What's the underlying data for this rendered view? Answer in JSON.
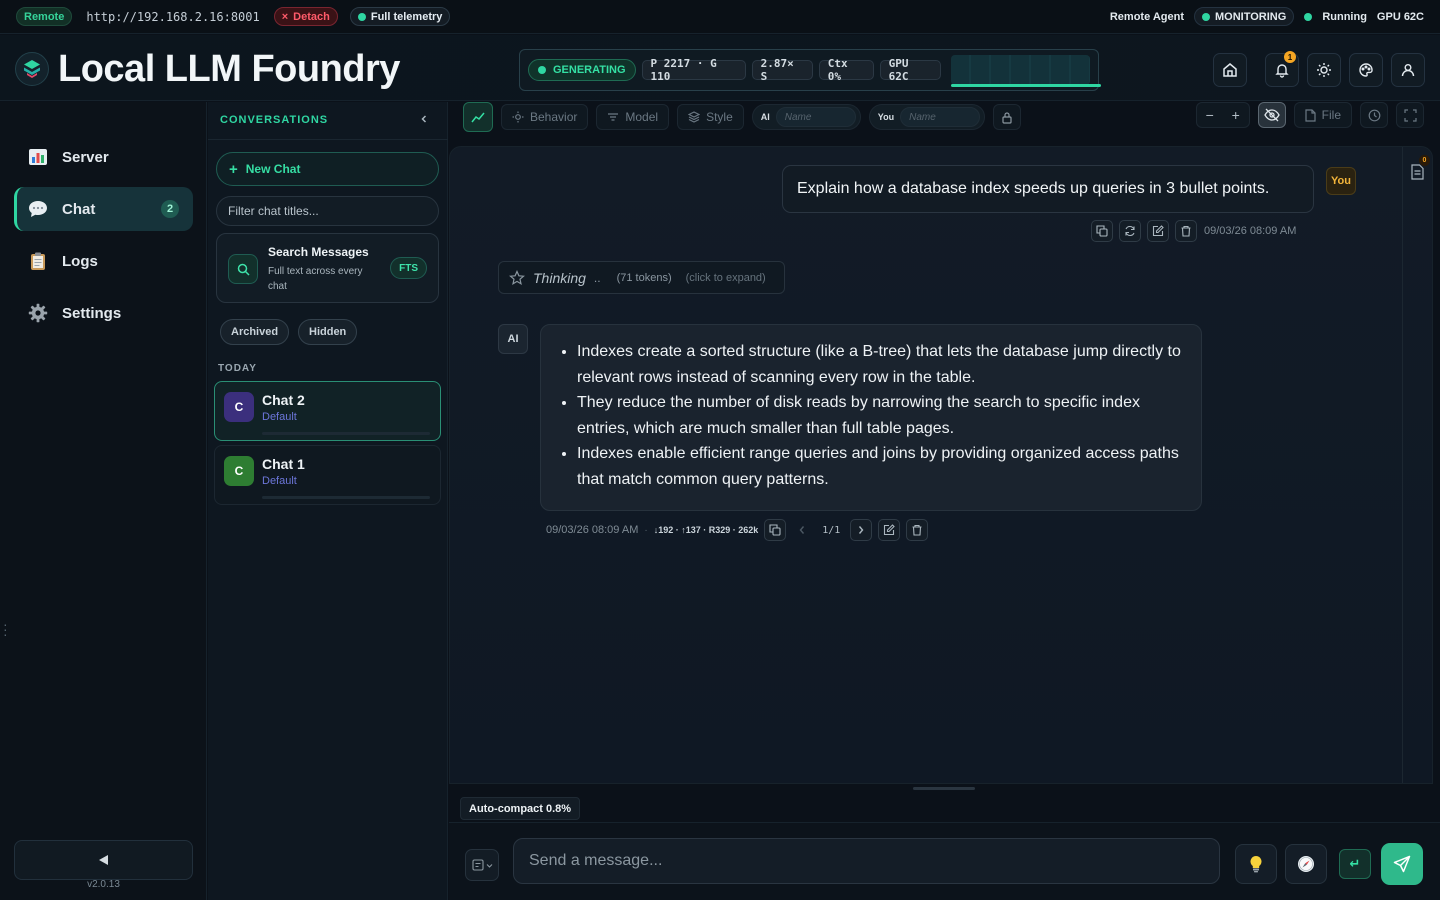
{
  "topbar": {
    "remote": "Remote",
    "url": "http://192.168.2.16:8001",
    "detach": "Detach",
    "telemetry": "Full telemetry",
    "remote_agent": "Remote Agent",
    "monitoring": "MONITORING",
    "running": "Running",
    "gpu": "GPU 62C"
  },
  "header": {
    "title": "Local LLM Foundry",
    "status": "GENERATING",
    "stats": [
      "P 2217 · G 110",
      "2.87× S",
      "Ctx 0%",
      "GPU 62C"
    ],
    "notifications": "1"
  },
  "nav": {
    "items": [
      {
        "label": "Server"
      },
      {
        "label": "Chat",
        "badge": "2"
      },
      {
        "label": "Logs"
      },
      {
        "label": "Settings"
      }
    ],
    "version": "v2.0.13"
  },
  "conversations": {
    "title": "CONVERSATIONS",
    "new_chat": "New Chat",
    "filter_placeholder": "Filter chat titles...",
    "search_title": "Search Messages",
    "search_sub": "Full text across every chat",
    "fts": "FTS",
    "archived": "Archived",
    "hidden": "Hidden",
    "group": "TODAY",
    "chats": [
      {
        "initial": "C",
        "name": "Chat 2",
        "model": "Default",
        "color": "#3b2f7d"
      },
      {
        "initial": "C",
        "name": "Chat 1",
        "model": "Default",
        "color": "#2e7d32"
      }
    ]
  },
  "toolbar": {
    "behavior": "Behavior",
    "model": "Model",
    "style": "Style",
    "ai_label": "AI",
    "you_label": "You",
    "name_placeholder": "Name",
    "file": "File"
  },
  "chat": {
    "user_message": "Explain how a database index speeds up queries in 3 bullet points.",
    "you_badge": "You",
    "user_time": "09/03/26 08:09 AM",
    "thinking": "Thinking",
    "thinking_dots": "..",
    "thinking_tokens": "(71 tokens)",
    "thinking_expand": "(click to expand)",
    "ai_badge": "AI",
    "ai_bullets": [
      "Indexes create a sorted structure (like a B-tree) that lets the database jump directly to relevant rows instead of scanning every row in the table.",
      "They reduce the number of disk reads by narrowing the search to specific index entries, which are much smaller than full table pages.",
      "Indexes enable efficient range queries and joins by providing organized access paths that match common query patterns."
    ],
    "ai_time": "09/03/26 08:09 AM",
    "ai_meta": "↓192 · ↑137 · R329 · 262k",
    "page": "1/1",
    "doc_count": "0"
  },
  "composer": {
    "auto_compact": "Auto-compact 0.8%",
    "placeholder": "Send a message...",
    "enter": "↵"
  }
}
